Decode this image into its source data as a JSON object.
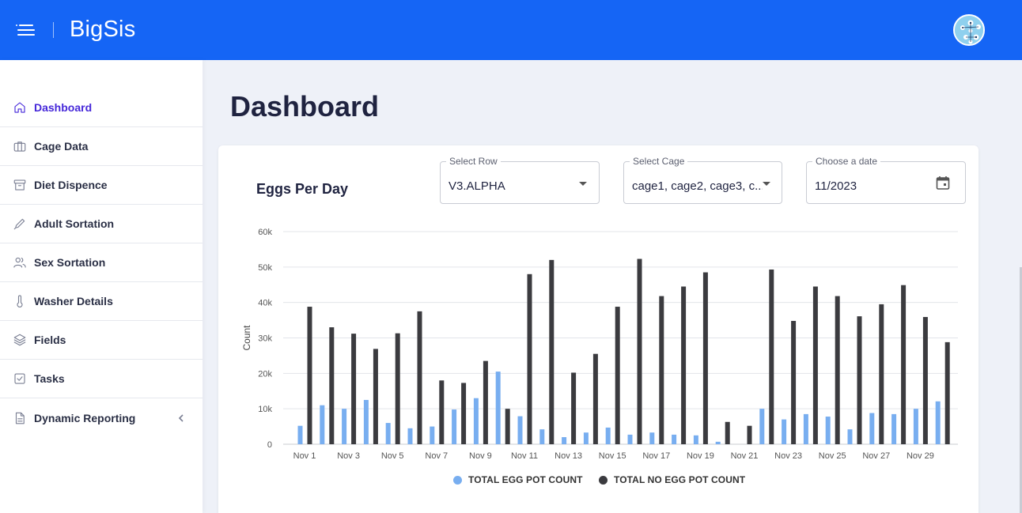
{
  "app": {
    "title": "BigSis"
  },
  "sidebar": {
    "items": [
      {
        "label": "Dashboard",
        "icon": "home-icon",
        "active": true
      },
      {
        "label": "Cage Data",
        "icon": "briefcase-icon"
      },
      {
        "label": "Diet Dispence",
        "icon": "archive-icon"
      },
      {
        "label": "Adult Sortation",
        "icon": "pen-icon"
      },
      {
        "label": "Sex Sortation",
        "icon": "users-icon"
      },
      {
        "label": "Washer Details",
        "icon": "thermometer-icon"
      },
      {
        "label": "Fields",
        "icon": "layers-icon"
      },
      {
        "label": "Tasks",
        "icon": "checkbox-icon"
      },
      {
        "label": "Dynamic Reporting",
        "icon": "document-icon",
        "has_submenu": true
      }
    ]
  },
  "main": {
    "title": "Dashboard"
  },
  "card": {
    "title": "Eggs Per Day",
    "filters": {
      "row": {
        "label": "Select Row",
        "value": "V3.ALPHA"
      },
      "cage": {
        "label": "Select Cage",
        "value": "cage1, cage2, cage3, c..."
      },
      "date": {
        "label": "Choose a date",
        "value": "11/2023"
      }
    }
  },
  "colors": {
    "header": "#1565f5",
    "active_nav": "#4527d9",
    "series_egg": "#78aef0",
    "series_no_egg": "#3b3b3f"
  },
  "chart_data": {
    "type": "bar",
    "ylabel": "Count",
    "xlabel": "",
    "ylim": [
      0,
      60000
    ],
    "yticks": [
      "0",
      "10k",
      "20k",
      "30k",
      "40k",
      "50k",
      "60k"
    ],
    "ytick_values": [
      0,
      10000,
      20000,
      30000,
      40000,
      50000,
      60000
    ],
    "grid": true,
    "legend_position": "bottom-center",
    "categories": [
      "Nov 1",
      "Nov 2",
      "Nov 3",
      "Nov 4",
      "Nov 5",
      "Nov 6",
      "Nov 7",
      "Nov 8",
      "Nov 9",
      "Nov 10",
      "Nov 11",
      "Nov 12",
      "Nov 13",
      "Nov 14",
      "Nov 15",
      "Nov 16",
      "Nov 17",
      "Nov 18",
      "Nov 19",
      "Nov 20",
      "Nov 21",
      "Nov 22",
      "Nov 23",
      "Nov 24",
      "Nov 25",
      "Nov 26",
      "Nov 27",
      "Nov 28",
      "Nov 29",
      "Nov 30"
    ],
    "xtick_labels": [
      "Nov 1",
      "",
      "Nov 3",
      "",
      "Nov 5",
      "",
      "Nov 7",
      "",
      "Nov 9",
      "",
      "Nov 11",
      "",
      "Nov 13",
      "",
      "Nov 15",
      "",
      "Nov 17",
      "",
      "Nov 19",
      "",
      "Nov 21",
      "",
      "Nov 23",
      "",
      "Nov 25",
      "",
      "Nov 27",
      "",
      "Nov 29",
      ""
    ],
    "series": [
      {
        "name": "TOTAL EGG POT COUNT",
        "color": "#78aef0",
        "values": [
          5200,
          11000,
          10000,
          12500,
          6000,
          4500,
          5000,
          9800,
          13000,
          20500,
          7900,
          4200,
          2000,
          3300,
          4700,
          2700,
          3300,
          2700,
          2500,
          700,
          0,
          10000,
          7000,
          8500,
          7800,
          4200,
          8800,
          8500,
          10000,
          12100
        ]
      },
      {
        "name": "TOTAL NO EGG POT COUNT",
        "color": "#3b3b3f",
        "values": [
          38800,
          33000,
          31200,
          26900,
          31300,
          37500,
          18000,
          17300,
          23500,
          10000,
          48000,
          52000,
          20200,
          25500,
          38800,
          52300,
          41800,
          44500,
          48500,
          6300,
          5200,
          49300,
          34800,
          44500,
          41800,
          36100,
          39500,
          44900,
          35900,
          28800
        ]
      }
    ]
  }
}
